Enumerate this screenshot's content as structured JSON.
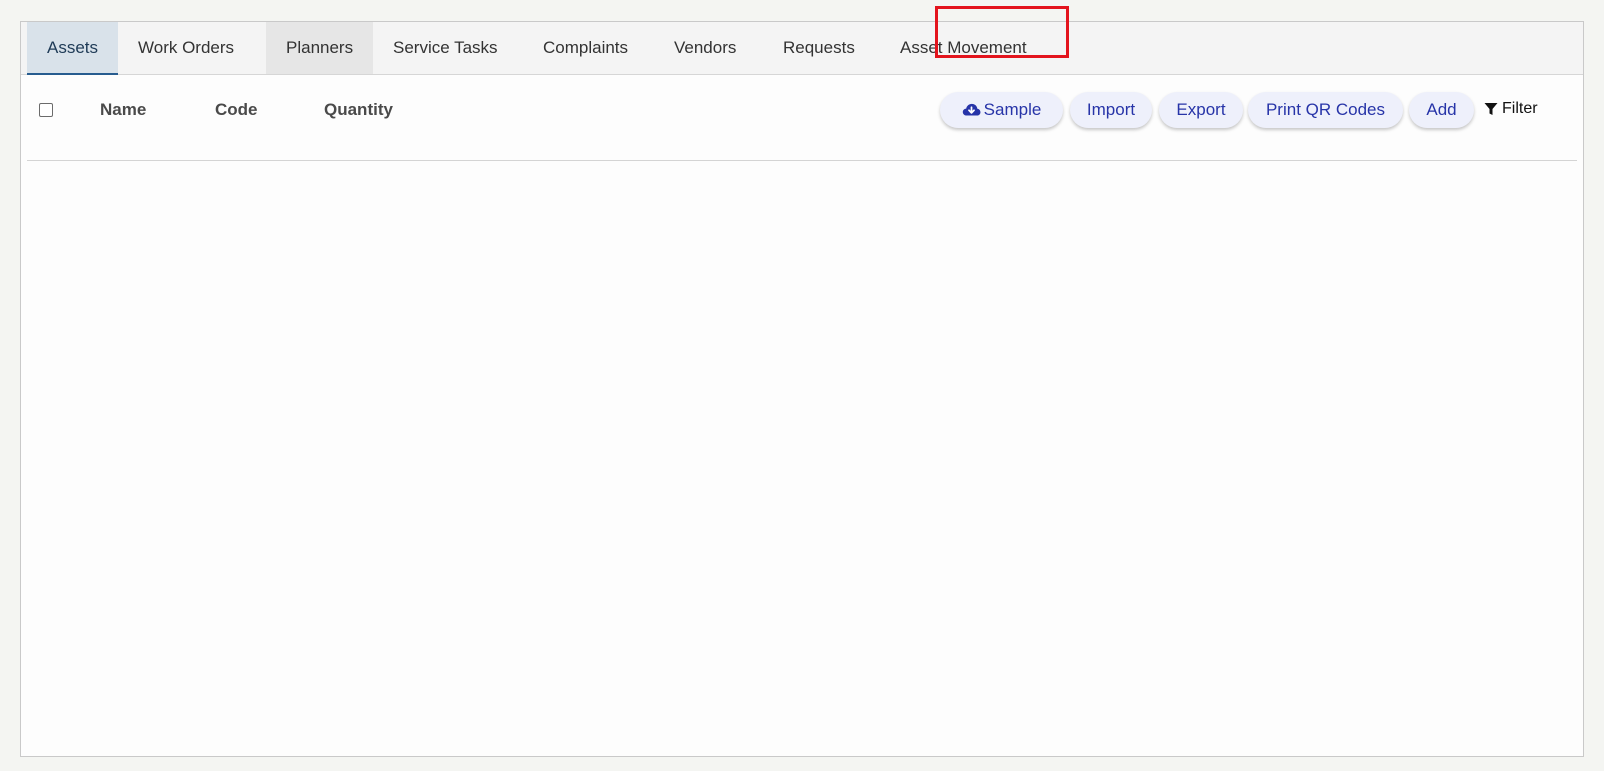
{
  "tabs": [
    {
      "label": "Assets"
    },
    {
      "label": "Work Orders"
    },
    {
      "label": "Planners"
    },
    {
      "label": "Service Tasks"
    },
    {
      "label": "Complaints"
    },
    {
      "label": "Vendors"
    },
    {
      "label": "Requests"
    },
    {
      "label": "Asset Movement"
    }
  ],
  "active_tab": "Assets",
  "hovered_tab": "Planners",
  "table": {
    "columns": [
      {
        "label": "Name"
      },
      {
        "label": "Code"
      },
      {
        "label": "Quantity"
      }
    ],
    "rows": []
  },
  "toolbar": {
    "sample_label": "Sample",
    "sample_icon": "cloud-download-icon",
    "import_label": "Import",
    "export_label": "Export",
    "print_qr_label": "Print QR Codes",
    "add_label": "Add",
    "filter_label": "Filter",
    "filter_icon": "filter-icon"
  },
  "colors": {
    "accent_text": "#2734a8",
    "button_bg": "#eef0fb",
    "highlight_border": "#e3141d",
    "active_tab_bg": "#d9e2ea",
    "active_tab_underline": "#275c8f"
  }
}
